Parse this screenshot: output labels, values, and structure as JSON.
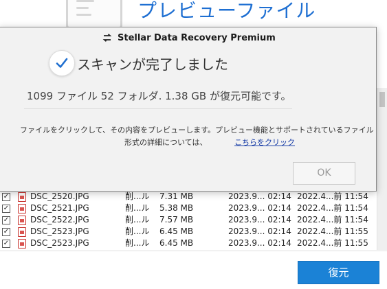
{
  "background": {
    "header_title": "プレビューファイル",
    "recover_button": "復元",
    "file_rows": [
      {
        "checked": "✓",
        "name": "DSC_2520.JPG",
        "type": "削...ル",
        "size": "7.31 MB",
        "created": "2023.9... 02:14",
        "modified": "2022.4...前 11:54"
      },
      {
        "checked": "✓",
        "name": "DSC_2521.JPG",
        "type": "削...ル",
        "size": "5.38 MB",
        "created": "2023.9... 02:14",
        "modified": "2022.4...前 11:54"
      },
      {
        "checked": "✓",
        "name": "DSC_2522.JPG",
        "type": "削...ル",
        "size": "7.57 MB",
        "created": "2023.9... 02:14",
        "modified": "2022.4...前 11:54"
      },
      {
        "checked": "✓",
        "name": "DSC_2523.JPG",
        "type": "削...ル",
        "size": "6.45 MB",
        "created": "2023.9... 02:14",
        "modified": "2022.4...前 11:55"
      },
      {
        "checked": "✓",
        "name": "DSC_2523.JPG",
        "type": "削...ル",
        "size": "6.45 MB",
        "created": "2023.9... 02:14",
        "modified": "2022.4...前 11:55"
      }
    ]
  },
  "dialog": {
    "title": "Stellar Data Recovery Premium",
    "logo_icon": "stellar-logo-icon",
    "status_icon": "checkmark-icon",
    "scan_status": "スキャンが完了しました",
    "summary": "1099 ファイル 52 フォルダ. 1.38 GB が復元可能です。",
    "info_line1": "ファイルをクリックして、その内容をプレビューします。プレビュー機能とサポートされているファイル",
    "info_line2": "形式の詳細については、",
    "info_link": "こちらをクリック",
    "ok_button": "OK"
  },
  "colors": {
    "accent": "#1b82d6",
    "title_blue": "#1e6fd2",
    "link": "#1a3fa8",
    "check_blue": "#1f6fd0",
    "file_icon_red": "#c9302c"
  }
}
